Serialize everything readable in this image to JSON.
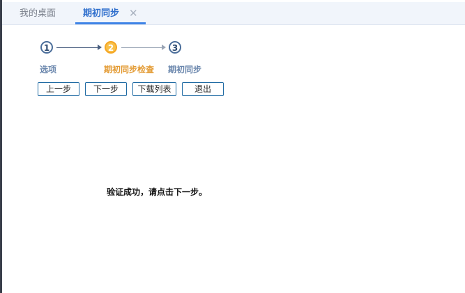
{
  "tabs": [
    {
      "label": "我的桌面",
      "active": false
    },
    {
      "label": "期初同步",
      "active": true,
      "close_icon": "close-icon",
      "close_glyph": "✕"
    }
  ],
  "wizard": {
    "steps": [
      {
        "number": "1",
        "label": "选项",
        "state": "done"
      },
      {
        "number": "2",
        "label": "期初同步检查",
        "state": "current"
      },
      {
        "number": "3",
        "label": "期初同步",
        "state": "pending"
      }
    ],
    "buttons": {
      "prev": "上一步",
      "next": "下一步",
      "download_list": "下载列表",
      "exit": "退出"
    }
  },
  "message": "验证成功，请点击下一步。",
  "colors": {
    "accent": "#3f84e6",
    "current_step": "#f5a623",
    "step_border": "#4a6d9a",
    "button_border": "#1f6aa3"
  }
}
